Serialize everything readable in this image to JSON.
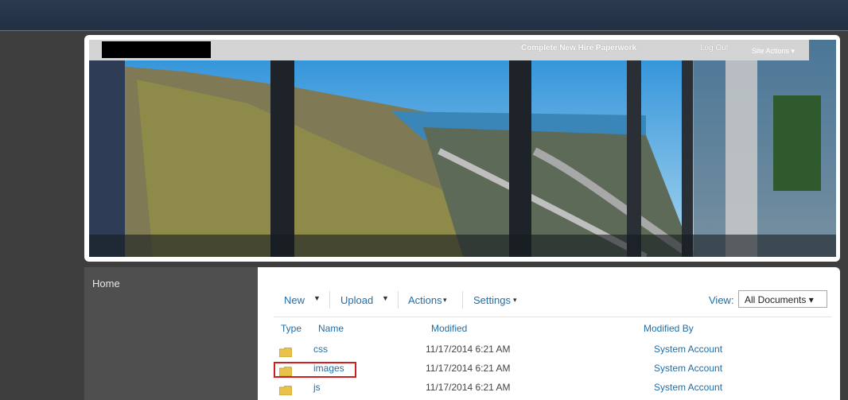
{
  "header": {
    "site_title_link": "Complete New Hire Paperwork",
    "logout": "Log Out",
    "site_actions": "Site Actions ▾"
  },
  "nav": {
    "home": "Home"
  },
  "toolbar": {
    "new": "New",
    "upload": "Upload",
    "actions": "Actions",
    "settings": "Settings",
    "view_label": "View:",
    "view_value": "All Documents ▾"
  },
  "columns": {
    "type": "Type",
    "name": "Name",
    "modified": "Modified",
    "modified_by": "Modified By"
  },
  "rows": [
    {
      "name": "css",
      "modified": "11/17/2014 6:21 AM",
      "modified_by": "System Account"
    },
    {
      "name": "images",
      "modified": "11/17/2014 6:21 AM",
      "modified_by": "System Account"
    },
    {
      "name": "js",
      "modified": "11/17/2014 6:21 AM",
      "modified_by": "System Account"
    }
  ],
  "colors": {
    "link": "#1e6ea8",
    "highlight": "#cc1f1f",
    "folder": "#e8c24a"
  }
}
